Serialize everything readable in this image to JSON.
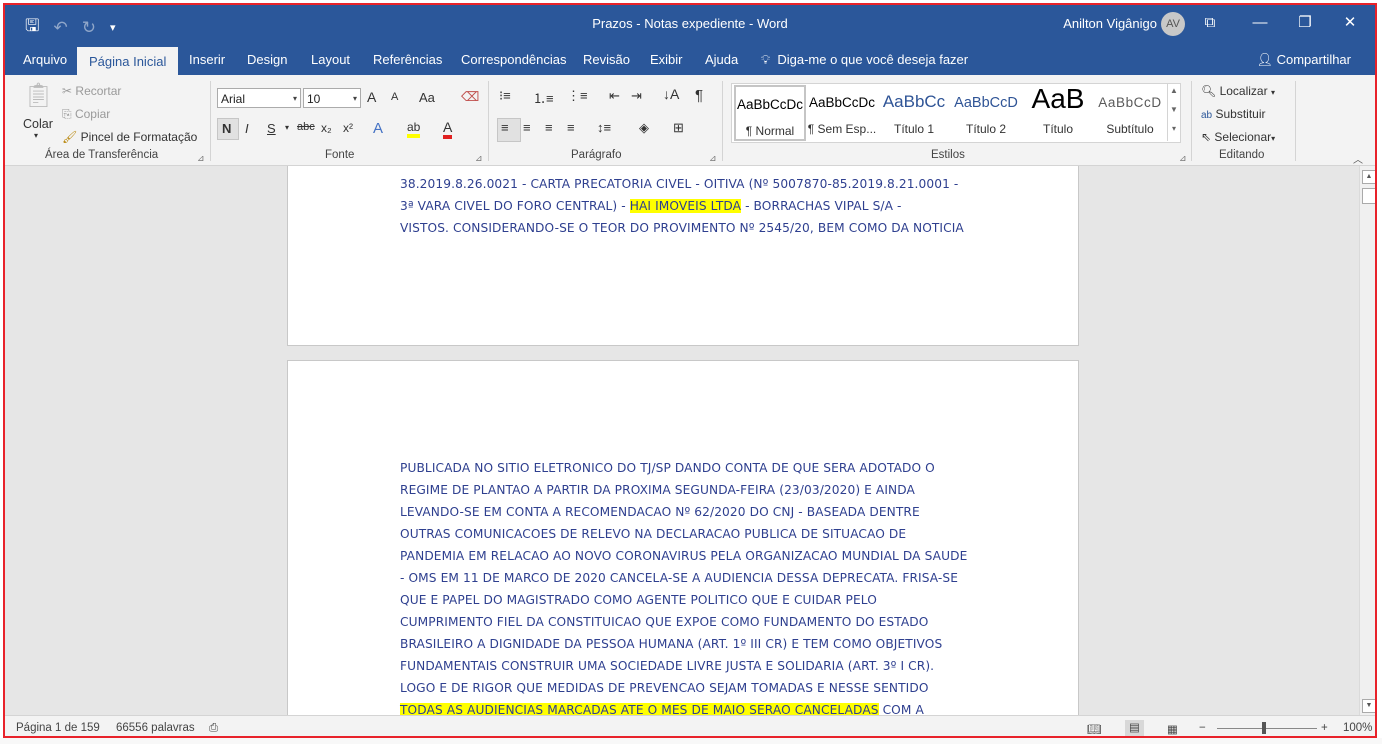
{
  "window": {
    "title": "Prazos  -  Notas expediente  -  Word",
    "user_name": "Anilton Vigânigo",
    "user_initials": "AV"
  },
  "qat": {
    "save_icon": "save-icon",
    "undo_icon": "undo-icon",
    "redo_icon": "redo-icon",
    "customize_icon": "customize-qat-icon"
  },
  "tabs": [
    {
      "label": "Arquivo"
    },
    {
      "label": "Página Inicial"
    },
    {
      "label": "Inserir"
    },
    {
      "label": "Design"
    },
    {
      "label": "Layout"
    },
    {
      "label": "Referências"
    },
    {
      "label": "Correspondências"
    },
    {
      "label": "Revisão"
    },
    {
      "label": "Exibir"
    },
    {
      "label": "Ajuda"
    }
  ],
  "tell_me": "Diga-me o que você deseja fazer",
  "share": "Compartilhar",
  "clipboard": {
    "paste": "Colar",
    "cut": "Recortar",
    "copy": "Copiar",
    "format_painter": "Pincel de Formatação",
    "group": "Área de Transferência"
  },
  "font": {
    "name": "Arial",
    "size": "10",
    "group": "Fonte",
    "bold": "N",
    "italic": "I",
    "underline": "S",
    "strike": "abc",
    "subscript": "x₂",
    "superscript": "x²",
    "grow": "A",
    "shrink": "A",
    "case": "Aa"
  },
  "paragraph": {
    "group": "Parágrafo"
  },
  "styles": {
    "group": "Estilos",
    "items": [
      {
        "preview": "AaBbCcDc",
        "name": "¶ Normal"
      },
      {
        "preview": "AaBbCcDc",
        "name": "¶ Sem Esp..."
      },
      {
        "preview": "AaBbCc",
        "name": "Título 1"
      },
      {
        "preview": "AaBbCcD",
        "name": "Título 2"
      },
      {
        "preview": "AaB",
        "name": "Título"
      },
      {
        "preview": "AaBbCcD",
        "name": "Subtítulo"
      }
    ]
  },
  "editing": {
    "group": "Editando",
    "find": "Localizar",
    "replace": "Substituir",
    "select": "Selecionar"
  },
  "doc": {
    "page1_lines": [
      "38.2019.8.26.0021 - CARTA PRECATORIA CIVEL - OITIVA (Nº 5007870-85.2019.8.21.0001 -",
      "3ª VARA CIVEL DO FORO CENTRAL) - ",
      "HAI IMOVEIS LTDA",
      " - BORRACHAS VIPAL S/A -",
      "VISTOS. CONSIDERANDO-SE O TEOR DO PROVIMENTO Nº 2545/20, BEM COMO DA NOTICIA"
    ],
    "page2_lines": [
      "PUBLICADA NO SITIO ELETRONICO DO TJ/SP DANDO CONTA DE QUE SERA ADOTADO O",
      "REGIME DE PLANTAO A PARTIR DA PROXIMA SEGUNDA-FEIRA (23/03/2020) E AINDA",
      "LEVANDO-SE EM CONTA A RECOMENDACAO Nº 62/2020 DO CNJ - BASEADA DENTRE",
      "OUTRAS COMUNICACOES DE RELEVO NA DECLARACAO PUBLICA DE SITUACAO DE",
      "PANDEMIA EM RELACAO AO NOVO CORONAVIRUS PELA ORGANIZACAO MUNDIAL DA SAUDE",
      "- OMS EM 11 DE MARCO DE 2020 CANCELA-SE A AUDIENCIA DESSA DEPRECATA. FRISA-SE",
      "QUE E PAPEL DO MAGISTRADO COMO AGENTE POLITICO QUE E CUIDAR PELO",
      "CUMPRIMENTO FIEL DA CONSTITUICAO QUE EXPOE COMO FUNDAMENTO DO ESTADO",
      "BRASILEIRO A DIGNIDADE DA PESSOA HUMANA (ART. 1º III CR) E TEM COMO OBJETIVOS",
      "FUNDAMENTAIS CONSTRUIR UMA SOCIEDADE LIVRE JUSTA E SOLIDARIA (ART. 3º I CR).",
      "LOGO E DE RIGOR QUE MEDIDAS DE PREVENCAO SEJAM TOMADAS E NESSE SENTIDO"
    ],
    "page2_last_hl": "TODAS AS AUDIENCIAS MARCADAS ATE O MES DE MAIO SERAO CANCELADAS",
    "page2_last_rest": " COM A"
  },
  "status": {
    "page": "Página 1 de 159",
    "words": "66556 palavras",
    "zoom": "100%",
    "zoom_minus": "−",
    "zoom_plus": "+"
  },
  "colors": {
    "accent": "#2b579a",
    "doc_text": "#2e3f8f",
    "highlight": "#ffff00",
    "frame": "#e8222a"
  }
}
